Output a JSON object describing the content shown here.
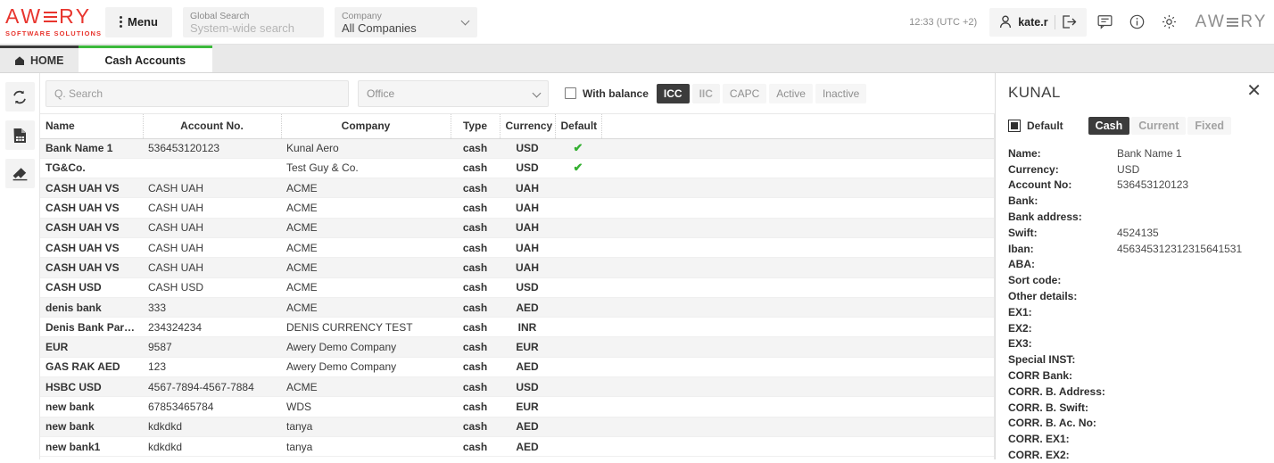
{
  "brand": {
    "name": "AWERY",
    "tagline": "SOFTWARE SOLUTIONS",
    "accent": "#e8352e"
  },
  "header": {
    "menu_label": "Menu",
    "global_search": {
      "label": "Global Search",
      "placeholder": "System-wide search",
      "value": ""
    },
    "company": {
      "label": "Company",
      "value": "All Companies"
    },
    "clock": "12:33 (UTC +2)",
    "user": "kate.r",
    "logout_icon": "logout-icon",
    "chat_icon": "chat-icon",
    "info_icon": "info-icon",
    "settings_icon": "gear-icon",
    "logo": "AWERY"
  },
  "tabs": [
    {
      "label": "HOME",
      "icon": "home-icon",
      "active": false
    },
    {
      "label": "Cash Accounts",
      "icon": "",
      "active": true
    }
  ],
  "rail": [
    {
      "name": "refresh-icon",
      "title": "Refresh"
    },
    {
      "name": "report-icon",
      "title": "Report"
    },
    {
      "name": "eraser-icon",
      "title": "Clear"
    }
  ],
  "filters": {
    "search_placeholder": "Q. Search",
    "search_value": "",
    "office": {
      "label": "Office",
      "value": ""
    },
    "with_balance": {
      "label": "With balance",
      "checked": false
    },
    "segments": [
      {
        "label": "ICC",
        "active": true
      },
      {
        "label": "IIC",
        "active": false
      },
      {
        "label": "CAPC",
        "active": false
      },
      {
        "label": "Active",
        "active": false
      },
      {
        "label": "Inactive",
        "active": false
      }
    ]
  },
  "table": {
    "columns": [
      "Name",
      "Account No.",
      "Company",
      "Type",
      "Currency",
      "Default",
      ""
    ],
    "rows": [
      {
        "name": "Bank Name 1",
        "account": "536453120123",
        "company": "Kunal Aero",
        "type": "cash",
        "currency": "USD",
        "default": true
      },
      {
        "name": "TG&Co.",
        "account": "",
        "company": "Test Guy & Co.",
        "type": "cash",
        "currency": "USD",
        "default": true
      },
      {
        "name": "CASH UAH VS",
        "account": "CASH UAH",
        "company": "ACME",
        "type": "cash",
        "currency": "UAH",
        "default": false
      },
      {
        "name": "CASH UAH VS",
        "account": "CASH UAH",
        "company": "ACME",
        "type": "cash",
        "currency": "UAH",
        "default": false
      },
      {
        "name": "CASH UAH VS",
        "account": "CASH UAH",
        "company": "ACME",
        "type": "cash",
        "currency": "UAH",
        "default": false
      },
      {
        "name": "CASH UAH VS",
        "account": "CASH UAH",
        "company": "ACME",
        "type": "cash",
        "currency": "UAH",
        "default": false
      },
      {
        "name": "CASH UAH VS",
        "account": "CASH UAH",
        "company": "ACME",
        "type": "cash",
        "currency": "UAH",
        "default": false
      },
      {
        "name": "CASH USD",
        "account": "CASH USD",
        "company": "ACME",
        "type": "cash",
        "currency": "USD",
        "default": false
      },
      {
        "name": "denis bank",
        "account": "333",
        "company": "ACME",
        "type": "cash",
        "currency": "AED",
        "default": false
      },
      {
        "name": "Denis Bank Parent ...",
        "account": "234324234",
        "company": "DENIS CURRENCY TEST",
        "type": "cash",
        "currency": "INR",
        "default": false
      },
      {
        "name": "EUR",
        "account": "9587",
        "company": "Awery Demo Company",
        "type": "cash",
        "currency": "EUR",
        "default": false
      },
      {
        "name": "GAS RAK AED",
        "account": "123",
        "company": "Awery Demo Company",
        "type": "cash",
        "currency": "AED",
        "default": false
      },
      {
        "name": "HSBC USD",
        "account": "4567-7894-4567-7884",
        "company": "ACME",
        "type": "cash",
        "currency": "USD",
        "default": false
      },
      {
        "name": "new bank",
        "account": "67853465784",
        "company": "WDS",
        "type": "cash",
        "currency": "EUR",
        "default": false
      },
      {
        "name": "new bank",
        "account": "kdkdkd",
        "company": "tanya",
        "type": "cash",
        "currency": "AED",
        "default": false
      },
      {
        "name": "new bank1",
        "account": "kdkdkd",
        "company": "tanya",
        "type": "cash",
        "currency": "AED",
        "default": false
      }
    ],
    "check_glyph": "✔"
  },
  "detail": {
    "title": "KUNAL",
    "close_glyph": "✕",
    "default_label": "Default",
    "default_checked": true,
    "type_segments": [
      {
        "label": "Cash",
        "active": true
      },
      {
        "label": "Current",
        "active": false
      },
      {
        "label": "Fixed",
        "active": false
      }
    ],
    "fields": [
      {
        "key": "Name:",
        "value": "Bank Name 1"
      },
      {
        "key": "Currency:",
        "value": "USD"
      },
      {
        "key": "Account No:",
        "value": "536453120123"
      },
      {
        "key": "Bank:",
        "value": ""
      },
      {
        "key": "Bank address:",
        "value": ""
      },
      {
        "key": "Swift:",
        "value": "4524135"
      },
      {
        "key": "Iban:",
        "value": "456345312312315641531"
      },
      {
        "key": "ABA:",
        "value": ""
      },
      {
        "key": "Sort code:",
        "value": ""
      },
      {
        "key": "Other details:",
        "value": ""
      },
      {
        "key": "EX1:",
        "value": ""
      },
      {
        "key": "EX2:",
        "value": ""
      },
      {
        "key": "EX3:",
        "value": ""
      },
      {
        "key": "Special INST:",
        "value": ""
      },
      {
        "key": "CORR Bank:",
        "value": ""
      },
      {
        "key": "CORR. B. Address:",
        "value": ""
      },
      {
        "key": "CORR. B. Swift:",
        "value": ""
      },
      {
        "key": "CORR. B. Ac. No:",
        "value": ""
      },
      {
        "key": "CORR. EX1:",
        "value": ""
      },
      {
        "key": "CORR. EX2:",
        "value": ""
      }
    ]
  }
}
